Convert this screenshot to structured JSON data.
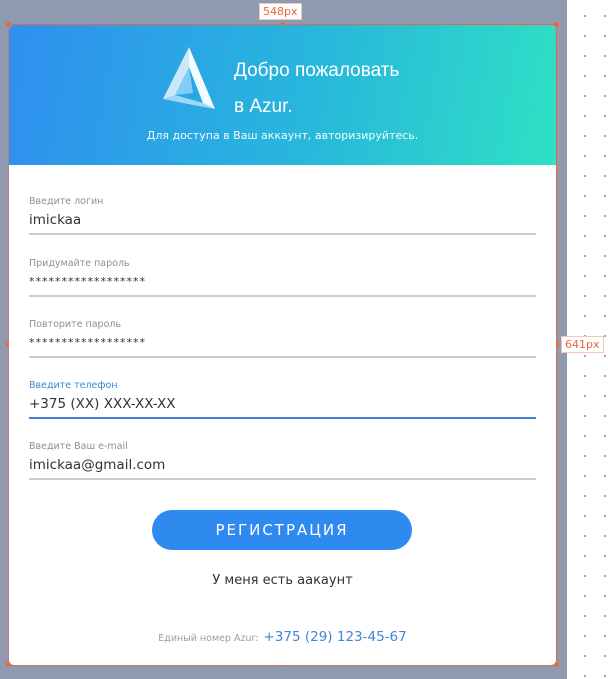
{
  "measurements": {
    "width_label": "548px",
    "height_label": "641px"
  },
  "header": {
    "title_line1": "Добро пожаловать",
    "title_line2": "в Azur.",
    "subtitle": "Для доступа в Ваш аккаунт, авторизируйтесь."
  },
  "form": {
    "login": {
      "label": "Введите логин",
      "value": "imickaa"
    },
    "password": {
      "label": "Придумайте пароль",
      "value": "******************"
    },
    "password_repeat": {
      "label": "Повторите пароль",
      "value": "******************"
    },
    "phone": {
      "label": "Введите телефон",
      "value": "+375 (XX) XXX-XX-XX"
    },
    "email": {
      "label": "Введите Ваш e-mail",
      "value": "imickaa@gmail.com"
    }
  },
  "actions": {
    "register_label": "РЕГИСТРАЦИЯ",
    "have_account_label": "У меня есть аакаунт"
  },
  "footer": {
    "text": "Единый номер Azur:",
    "phone": "+375 (29) 123-45-67"
  },
  "colors": {
    "accent": "#2f8af0",
    "gradient_start": "#2f8ff0",
    "gradient_end": "#2fe0c4",
    "guide": "#e9663e"
  }
}
